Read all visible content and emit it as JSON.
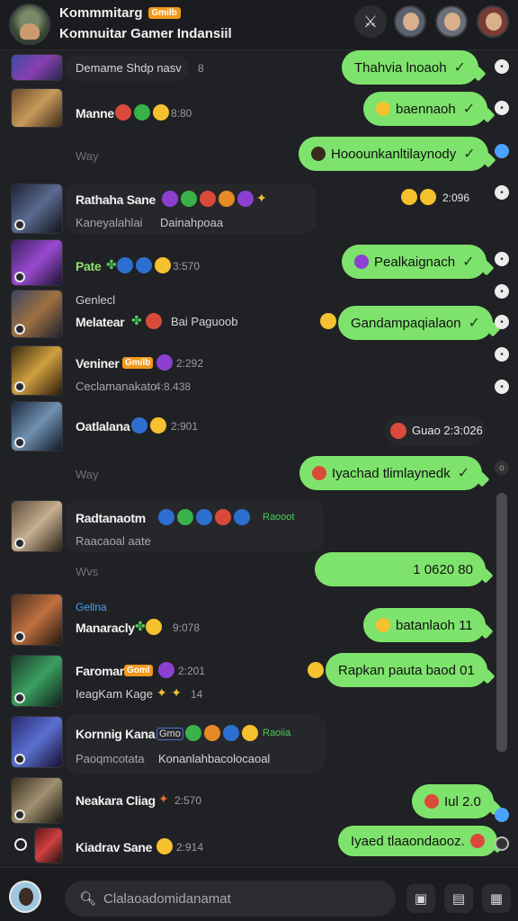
{
  "header": {
    "title": "Kommmitarg",
    "title_badge": "Gmilb",
    "subtitle": "Komnuitar Gamer Indansiil",
    "action_icon": "sword-icon"
  },
  "rows": [
    {
      "name": "Demame Shdp nasv",
      "time": "8"
    },
    {
      "name": "Manne",
      "time": "8:80"
    },
    {
      "name": "Rathaha Sane",
      "time": "2:096",
      "sub": "Kaneyalahlai",
      "sub2": "Dainahpoaa"
    },
    {
      "name": "Pate",
      "time": "3:570"
    },
    {
      "name": "Genlecl",
      "line2": "Melatear",
      "extra": "Bai Paguoob"
    },
    {
      "name": "Veniner",
      "badge": "Gmilb",
      "time": "2:292",
      "sub": "Ceclamanakato",
      "sub_time": "4:8.438"
    },
    {
      "name": "Oatlalana",
      "time": "2:901"
    },
    {
      "name": "Radtanaotm",
      "tag": "Raooot",
      "sub": "Raacaoal aate"
    },
    {
      "name": "Manaracly",
      "label": "Gellna",
      "time": "9:078"
    },
    {
      "name": "Faromar",
      "badge": "Goml",
      "time": "2:201",
      "sub": "IeagKam Kage",
      "sub_time": "14"
    },
    {
      "name": "Kornnig Kana",
      "badge": "Gmo",
      "tag": "Raoiia",
      "sub": "Paoqmcotata",
      "sub2": "Konanlahbacolocaoal"
    },
    {
      "name": "Neakara Cliag",
      "time": "2:570"
    },
    {
      "name": "Kiadrav Sane",
      "time": "2:914"
    }
  ],
  "dividers": [
    "Way",
    "Way",
    "Wvs"
  ],
  "bubbles": [
    {
      "text": "Thahvia lnoaoh"
    },
    {
      "text": "baennaoh"
    },
    {
      "text": "Hooounkanltilaynody"
    },
    {
      "text": "Pealkaignach"
    },
    {
      "text": "Gandampaqialaon"
    },
    {
      "text": "Guao 2:3:026"
    },
    {
      "text": "Iyachad tlimlaynedk"
    },
    {
      "text": "1 0620 80"
    },
    {
      "text": "batanlaoh 11"
    },
    {
      "text": "Rapkan pauta baod 01"
    },
    {
      "text": "Iul 2.0"
    },
    {
      "text": "Iyaed tlaaondaooz."
    }
  ],
  "side_times": [
    "2:096"
  ],
  "footer": {
    "search_placeholder": "Clalaoadomidanamat"
  },
  "colors": {
    "bubble": "#7ee36c",
    "background": "#202124",
    "badge": "#f29a1c"
  }
}
